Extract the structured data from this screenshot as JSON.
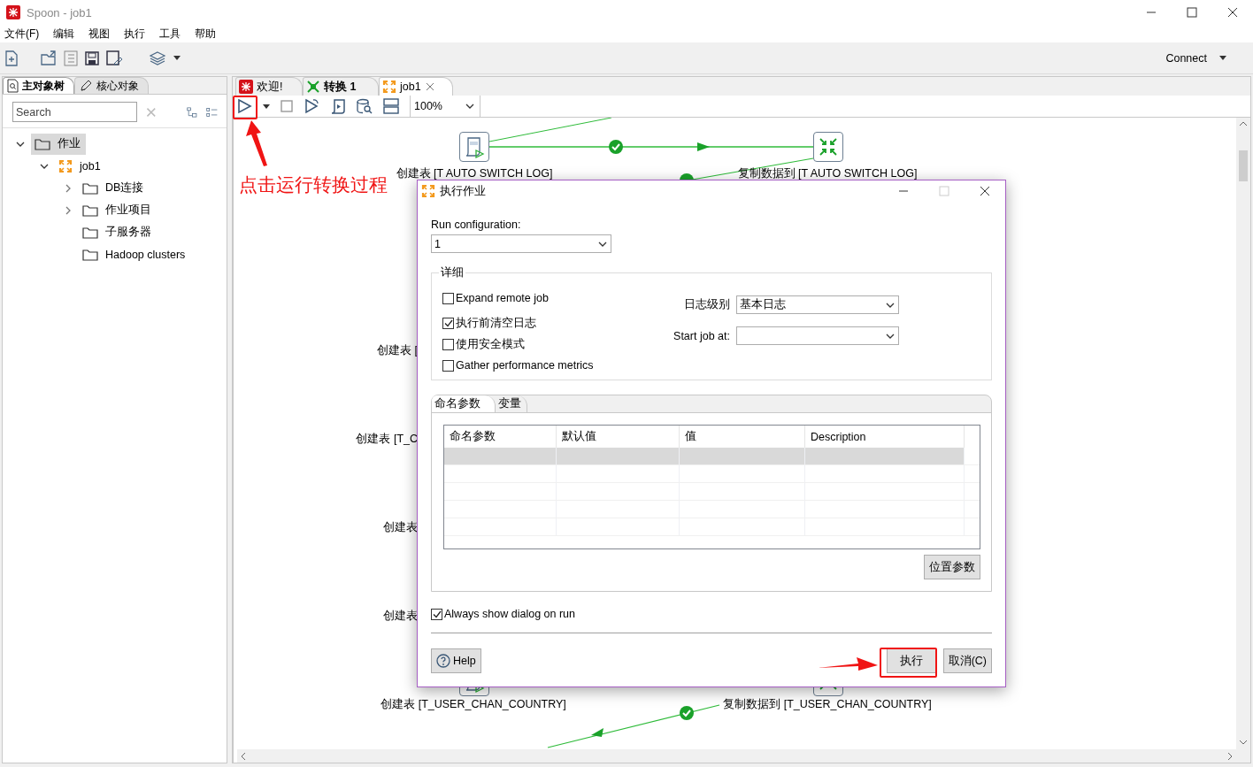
{
  "window": {
    "title": "Spoon - job1"
  },
  "menu": [
    "文件(F)",
    "编辑",
    "视图",
    "执行",
    "工具",
    "帮助"
  ],
  "toolbar": {
    "connect": "Connect"
  },
  "left_panel": {
    "tabs": [
      {
        "label": "主对象树",
        "kind": "tree",
        "selected": true
      },
      {
        "label": "核心对象",
        "kind": "pencil",
        "selected": false
      }
    ],
    "search": {
      "placeholder": "Search"
    },
    "tree": [
      {
        "label": "作业",
        "kind": "folder",
        "expanded": true,
        "selected": true,
        "children": [
          {
            "label": "job1",
            "kind": "job",
            "expanded": true,
            "selected": false,
            "children": [
              {
                "label": "DB连接",
                "kind": "folder",
                "expanded": false,
                "selected": false
              },
              {
                "label": "作业项目",
                "kind": "folder",
                "expanded": false,
                "selected": false
              },
              {
                "label": "子服务器",
                "kind": "folder",
                "selected": false
              },
              {
                "label": "Hadoop clusters",
                "kind": "folder",
                "selected": false
              }
            ]
          }
        ]
      }
    ]
  },
  "editor_tabs": [
    {
      "label": "欢迎!",
      "kind": "welcome",
      "selected": false
    },
    {
      "label": "转换 1",
      "kind": "transformation",
      "selected": false
    },
    {
      "label": "job1",
      "kind": "job",
      "selected": true
    }
  ],
  "zoom": "100%",
  "canvas": {
    "steps": [
      {
        "kind": "sql",
        "label": "创建表 [T AUTO SWITCH LOG]"
      },
      {
        "kind": "copy",
        "label": "复制数据到 [T AUTO SWITCH LOG]"
      },
      {
        "label": "创建表 ["
      },
      {
        "label": "创建表 [T_C"
      },
      {
        "label": "创建表"
      },
      {
        "label": "创建表"
      },
      {
        "kind": "sql",
        "label": "创建表 [T_USER_CHAN_COUNTRY]"
      },
      {
        "kind": "copy",
        "label": "复制数据到 [T_USER_CHAN_COUNTRY]"
      }
    ]
  },
  "annotation": {
    "text": "点击运行转换过程"
  },
  "dialog": {
    "title": "执行作业",
    "run_configuration": {
      "label": "Run configuration:",
      "value": "1"
    },
    "details": {
      "title": "详细",
      "options": [
        {
          "label": "Expand remote job",
          "checked": false
        },
        {
          "label": "执行前清空日志",
          "checked": true
        },
        {
          "label": "使用安全模式",
          "checked": false
        },
        {
          "label": "Gather performance metrics",
          "checked": false
        }
      ],
      "log_level": {
        "label": "日志级别",
        "value": "基本日志"
      },
      "start_job_at": {
        "label": "Start job at:"
      }
    },
    "tabs": [
      {
        "label": "命名参数",
        "selected": true
      },
      {
        "label": "变量",
        "selected": false
      }
    ],
    "table": {
      "columns": [
        "命名参数",
        "默认值",
        "值",
        "Description"
      ],
      "rows": [
        {
          "selected": true
        },
        {
          "selected": false
        },
        {
          "selected": false
        },
        {
          "selected": false
        },
        {
          "selected": false
        }
      ]
    },
    "position_params_button": "位置参数",
    "always_show": {
      "label": "Always show dialog on run",
      "checked": true
    },
    "help_button": "Help",
    "run_button": "执行",
    "cancel_button": "取消(C)"
  }
}
